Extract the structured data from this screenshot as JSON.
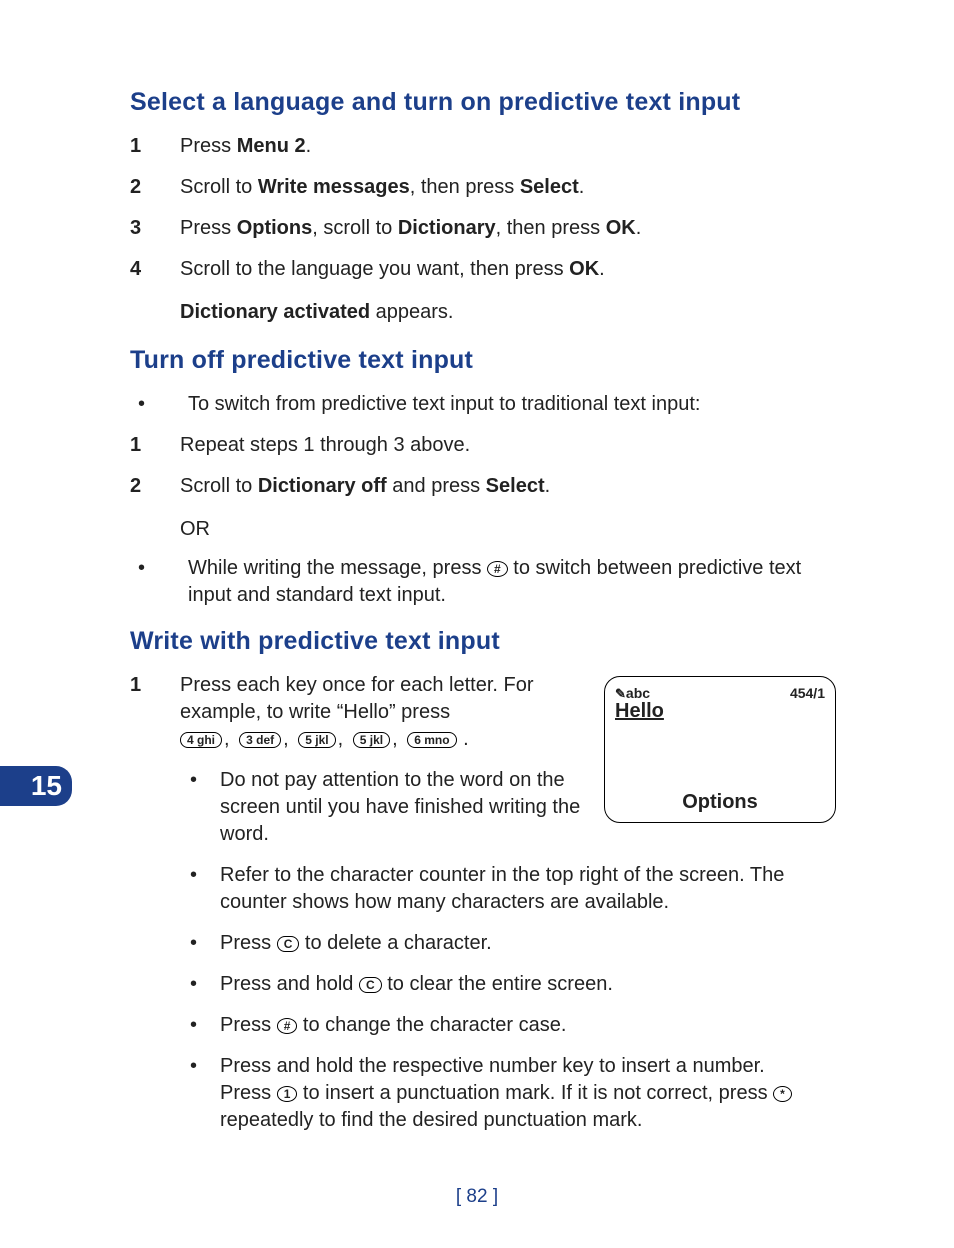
{
  "page": {
    "number_label": "[ 82 ]",
    "side_tab": "15"
  },
  "s1": {
    "title": "Select a language and turn on predictive text input",
    "steps": [
      {
        "n": "1",
        "pre": "Press ",
        "b1": "Menu 2",
        "post": "."
      },
      {
        "n": "2",
        "pre": "Scroll to ",
        "b1": "Write messages",
        "mid": ", then press ",
        "b2": "Select",
        "post": "."
      },
      {
        "n": "3",
        "pre": "Press ",
        "b1": "Options",
        "mid": ", scroll to ",
        "b2": "Dictionary",
        "mid2": ", then press ",
        "b3": "OK",
        "post": "."
      },
      {
        "n": "4",
        "pre": "Scroll to the language you want, then press ",
        "b1": "OK",
        "post": "."
      }
    ],
    "trailer_bold": "Dictionary activated",
    "trailer_post": " appears."
  },
  "s2": {
    "title": "Turn off predictive text input",
    "bullet1": "To switch from predictive text input to traditional text input:",
    "step1": {
      "n": "1",
      "text": "Repeat steps 1 through 3 above."
    },
    "step2": {
      "n": "2",
      "pre": "Scroll to ",
      "b1": "Dictionary off",
      "mid": " and press ",
      "b2": "Select",
      "post": "."
    },
    "or": "OR",
    "bullet2_pre": "While writing the message, press ",
    "bullet2_key": "#",
    "bullet2_post": " to switch between predictive text input and standard text input."
  },
  "s3": {
    "title": "Write with predictive text input",
    "step1_line1": "Press each key once for each letter. For example, to write “Hello” press",
    "keys": [
      "4 ghi",
      "3 def",
      "5 jkl",
      "5 jkl",
      "6 mno"
    ],
    "phone": {
      "mode": "abc",
      "counter": "454/1",
      "word": "Hello",
      "softkey": "Options"
    },
    "sub": [
      "Do not pay attention to the word on the screen until you have finished writing the word.",
      "Refer to the character counter in the top right of the screen. The counter shows how many characters are available."
    ],
    "sub_c1_pre": "Press ",
    "sub_c1_key": "C",
    "sub_c1_post": " to delete a character.",
    "sub_c2_pre": "Press and hold ",
    "sub_c2_key": "C",
    "sub_c2_post": " to clear the entire screen.",
    "sub_hash_pre": "Press ",
    "sub_hash_key": "#",
    "sub_hash_post": " to change the character case.",
    "sub_num_line1": "Press and hold the respective number key to insert a number.",
    "sub_num_pre2": "Press ",
    "sub_num_key1": "1",
    "sub_num_mid2": " to insert a punctuation mark. If it is not correct, press ",
    "sub_num_key2": "*",
    "sub_num_post2": " repeatedly to find the desired punctuation mark."
  }
}
